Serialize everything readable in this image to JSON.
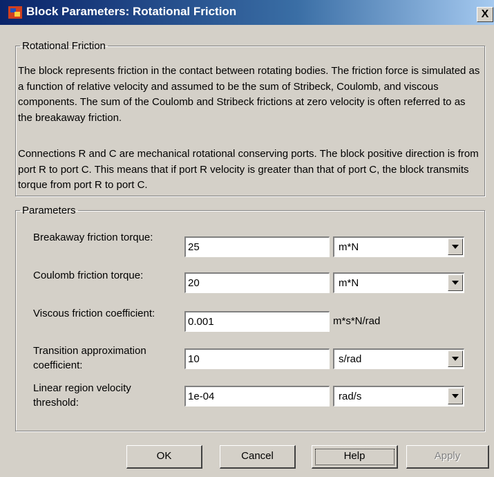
{
  "window": {
    "title": "Block Parameters: Rotational Friction",
    "close_label": "X",
    "icon": "simulink-block-icon"
  },
  "description_group": {
    "legend": "Rotational Friction",
    "paragraph1": "The block represents friction in the contact between rotating bodies. The friction force is simulated as a function of relative velocity and assumed to be the sum of Stribeck, Coulomb, and viscous components. The sum of the Coulomb and Stribeck frictions at zero velocity is often referred to as the breakaway friction.",
    "paragraph2": "Connections R and C are mechanical rotational conserving ports. The block positive direction is from port R to port C. This means that if port R velocity is greater than that of port C, the block transmits torque from port R to port C."
  },
  "parameters_group": {
    "legend": "Parameters",
    "breakaway": {
      "label": "Breakaway friction torque:",
      "value": "25",
      "unit": "m*N"
    },
    "coulomb": {
      "label": "Coulomb friction torque:",
      "value": "20",
      "unit": "m*N"
    },
    "viscous": {
      "label": "Viscous friction coefficient:",
      "value": "0.001",
      "unit": "m*s*N/rad"
    },
    "transition": {
      "label_line1": "Transition approximation",
      "label_line2": "coefficient:",
      "value": "10",
      "unit": "s/rad"
    },
    "linear": {
      "label_line1": "Linear region velocity",
      "label_line2": "threshold:",
      "value": "1e-04",
      "unit": "rad/s"
    }
  },
  "buttons": {
    "ok": "OK",
    "cancel": "Cancel",
    "help": "Help",
    "apply": "Apply"
  }
}
